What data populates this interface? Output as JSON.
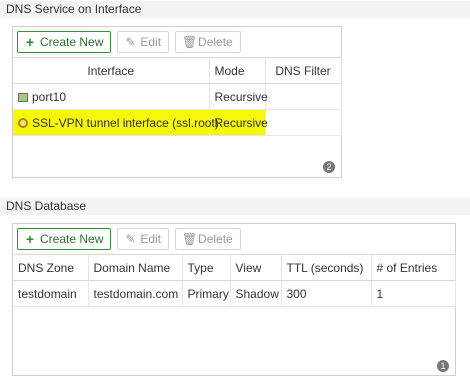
{
  "dns_service": {
    "title": "DNS Service on Interface",
    "toolbar": {
      "create": "Create New",
      "edit": "Edit",
      "delete": "Delete"
    },
    "columns": [
      "Interface",
      "Mode",
      "DNS Filter"
    ],
    "rows": [
      {
        "interface": "port10",
        "mode": "Recursive",
        "filter": "",
        "icon": "port-icon"
      },
      {
        "interface": "SSL-VPN tunnel interface (ssl.root)",
        "mode": "Recursive",
        "filter": "",
        "icon": "vpn-icon",
        "highlighted": true
      }
    ],
    "count": "2",
    "highlight_color": "#f7f70a"
  },
  "dns_database": {
    "title": "DNS Database",
    "toolbar": {
      "create": "Create New",
      "edit": "Edit",
      "delete": "Delete"
    },
    "columns": [
      "DNS Zone",
      "Domain Name",
      "Type",
      "View",
      "TTL (seconds)",
      "# of Entries"
    ],
    "rows": [
      {
        "zone": "testdomain",
        "domain": "testdomain.com",
        "type": "Primary",
        "view": "Shadow",
        "ttl": "300",
        "entries": "1"
      }
    ],
    "count": "1"
  },
  "colors": {
    "accent_green": "#2b8a2b",
    "badge": "#777777"
  }
}
